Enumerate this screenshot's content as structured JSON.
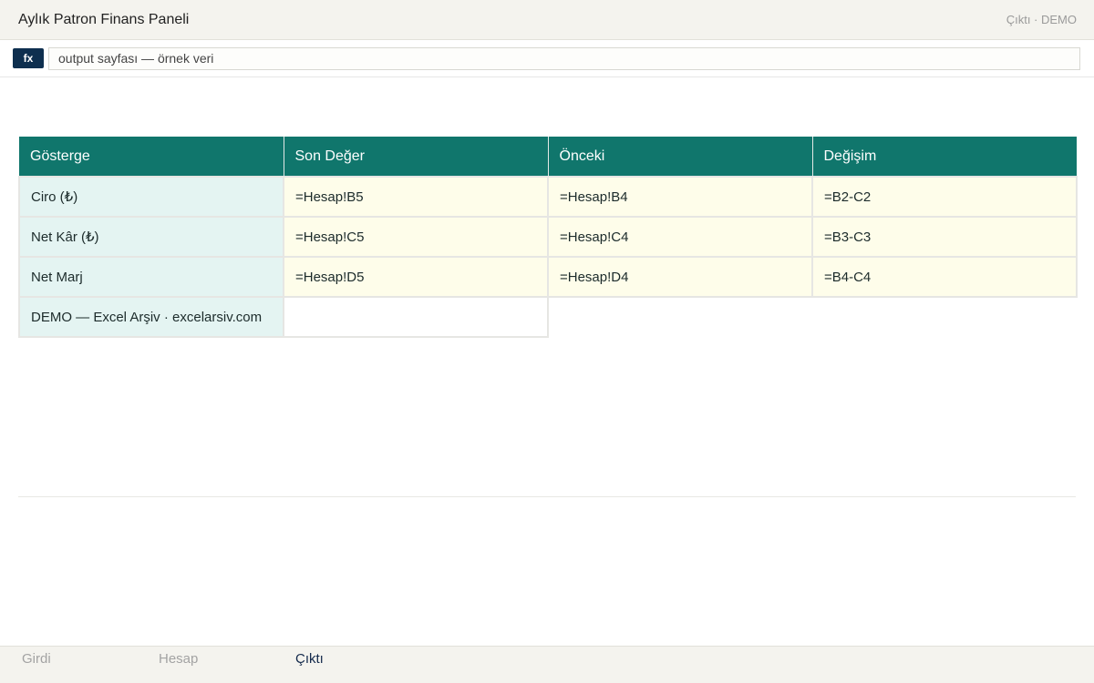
{
  "window": {
    "title": "Aylık Patron Finans Paneli",
    "status": "Çıktı · DEMO"
  },
  "formula_bar": {
    "fx_label": "fx",
    "value": "output sayfası — örnek veri"
  },
  "table": {
    "headers": [
      "Gösterge",
      "Son Değer",
      "Önceki",
      "Değişim"
    ],
    "rows": [
      [
        "Ciro (₺)",
        "=Hesap!B5",
        "=Hesap!B4",
        "=B2-C2"
      ],
      [
        "Net Kâr (₺)",
        "=Hesap!C5",
        "=Hesap!C4",
        "=B3-C3"
      ],
      [
        "Net Marj",
        "=Hesap!D5",
        "=Hesap!D4",
        "=B4-C4"
      ]
    ],
    "footer_row": [
      "DEMO — Excel Arşiv · excelarsiv.com",
      ""
    ]
  },
  "tabs": [
    {
      "label": "Girdi",
      "active": false
    },
    {
      "label": "Hesap",
      "active": false
    },
    {
      "label": "Çıktı",
      "active": true
    }
  ],
  "colors": {
    "header_bg": "#10766c",
    "label_cell_bg": "#e4f4f2",
    "value_cell_bg": "#fefdea",
    "fx_badge_bg": "#0e2f4f",
    "active_tab": "#13294b"
  }
}
